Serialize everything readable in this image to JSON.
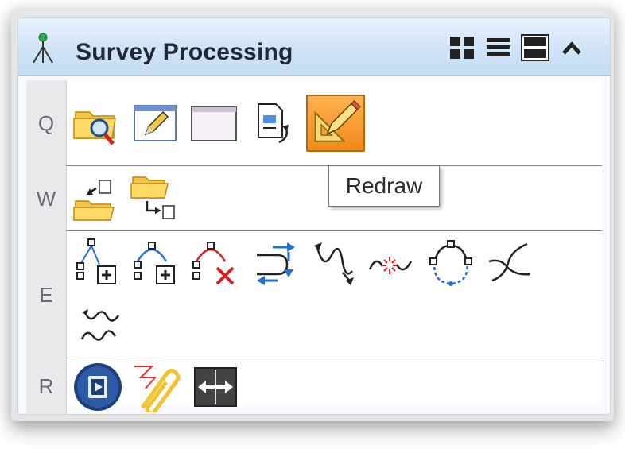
{
  "panel": {
    "title": "Survey Processing",
    "title_icon": "survey-tripod-icon",
    "toolbar": [
      "grid-view-icon",
      "list-view-icon",
      "split-view-icon",
      "collapse-chevron-icon"
    ]
  },
  "rows": [
    {
      "label": "Q",
      "tools": [
        "folder-search-icon",
        "edit-pencil-icon",
        "window-icon",
        "document-refresh-icon",
        "redraw-icon"
      ]
    },
    {
      "label": "W",
      "tools": [
        "folder-import-icon",
        "folder-export-icon"
      ]
    },
    {
      "label": "E",
      "tools": [
        "node-split-add-icon",
        "arc-node-add-icon",
        "arc-node-delete-icon",
        "reverse-direction-icon",
        "line-direction-icon",
        "break-line-icon",
        "closed-shape-icon",
        "cross-lines-icon",
        "offset-lines-icon"
      ]
    },
    {
      "label": "R",
      "tools": [
        "play-media-icon",
        "paperclip-icon",
        "expand-horizontal-icon"
      ]
    }
  ],
  "tooltip": {
    "text": "Redraw"
  },
  "colors": {
    "header": "#cfe3f7",
    "active": "#f5a030",
    "row_label_bg": "#e9e9ec"
  }
}
